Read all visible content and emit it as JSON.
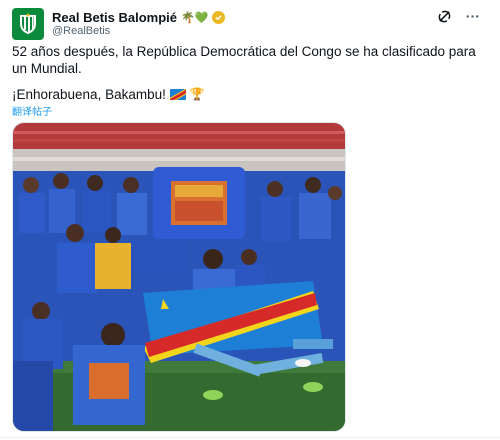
{
  "account": {
    "display_name": "Real Betis Balompié",
    "name_emojis": "🌴💚",
    "handle": "@RealBetis"
  },
  "header_icons": [
    "grok-icon",
    "more-icon"
  ],
  "tweet": {
    "text": "52 años después, la República Democrática del Congo se ha clasificado para un Mundial.",
    "line2": "¡Enhorabuena, Bakambu!",
    "trophy_emoji": "🏆",
    "translate_label": "翻译帖子"
  },
  "media": {
    "description_alt": "photo"
  },
  "colors": {
    "betis_green": "#0b8a3c",
    "link_blue": "#1d9bf0",
    "verified_gold": "#e8b923"
  }
}
